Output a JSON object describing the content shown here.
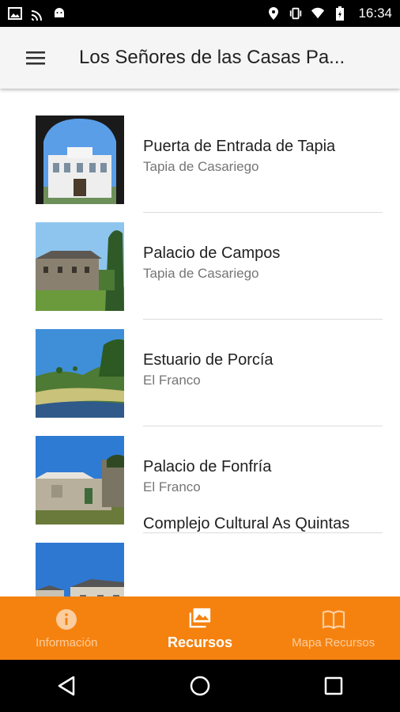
{
  "status_bar": {
    "time": "16:34",
    "icons_left": [
      "image-icon",
      "cast-icon",
      "android-icon"
    ],
    "icons_right": [
      "location-icon",
      "vibrate-icon",
      "wifi-icon",
      "battery-charging-icon"
    ]
  },
  "app_bar": {
    "menu_icon": "hamburger-icon",
    "title": "Los Señores de las Casas Pa..."
  },
  "items": [
    {
      "title": "Puerta de Entrada de Tapia",
      "subtitle": "Tapia de Casariego",
      "image": "building-arch-photo"
    },
    {
      "title": "Palacio de Campos",
      "subtitle": "Tapia de Casariego",
      "image": "stone-manor-photo"
    },
    {
      "title": "Estuario de Porcía",
      "subtitle": "El Franco",
      "image": "estuary-photo"
    },
    {
      "title": "Palacio de Fonfría",
      "subtitle": "El Franco",
      "image": "stone-palace-photo"
    },
    {
      "title": "Complejo Cultural As Quintas",
      "subtitle": "",
      "image": "cultural-complex-photo"
    }
  ],
  "bottom_nav": {
    "items": [
      {
        "label": "Información",
        "icon": "info-icon",
        "active": false
      },
      {
        "label": "Recursos",
        "icon": "photos-icon",
        "active": true
      },
      {
        "label": "Mapa Recursos",
        "icon": "book-map-icon",
        "active": false
      }
    ]
  },
  "system_nav": [
    "back-icon",
    "home-icon",
    "recents-icon"
  ],
  "colors": {
    "accent": "#f5820f",
    "app_bar": "#f5f5f5",
    "title_text": "#212121",
    "subtitle_text": "#757575"
  }
}
